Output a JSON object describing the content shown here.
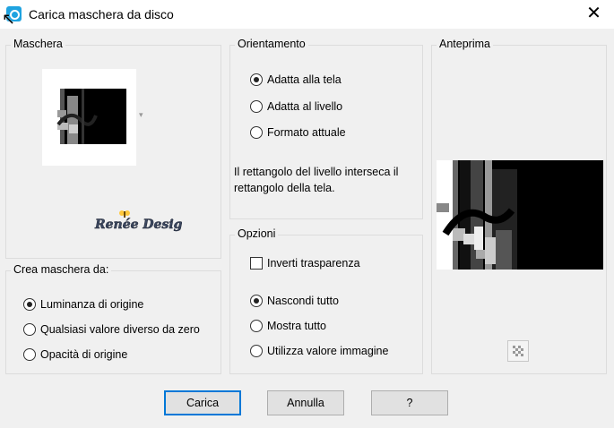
{
  "window": {
    "title": "Carica maschera da disco",
    "close_glyph": "✕"
  },
  "mask_group": {
    "legend": "Maschera"
  },
  "create_group": {
    "legend": "Crea maschera da:",
    "options": [
      {
        "label": "Luminanza di origine",
        "selected": true
      },
      {
        "label": "Qualsiasi valore diverso da zero",
        "selected": false
      },
      {
        "label": "Opacità di origine",
        "selected": false
      }
    ]
  },
  "orientation_group": {
    "legend": "Orientamento",
    "options": [
      {
        "label": "Adatta alla tela",
        "selected": true
      },
      {
        "label": "Adatta al livello",
        "selected": false
      },
      {
        "label": "Formato attuale",
        "selected": false
      }
    ],
    "description": [
      "Il rettangolo del livello interseca il",
      "rettangolo della tela."
    ]
  },
  "options_group": {
    "legend": "Opzioni",
    "invert_label": "Inverti trasparenza",
    "invert_checked": false,
    "options": [
      {
        "label": "Nascondi tutto",
        "selected": true
      },
      {
        "label": "Mostra tutto",
        "selected": false
      },
      {
        "label": "Utilizza valore immagine",
        "selected": false
      }
    ]
  },
  "preview_group": {
    "legend": "Anteprima"
  },
  "buttons": {
    "load": "Carica",
    "cancel": "Annulla",
    "help": "?"
  },
  "colors": {
    "accent": "#0078d7",
    "app_icon": "#1fa3e0"
  }
}
